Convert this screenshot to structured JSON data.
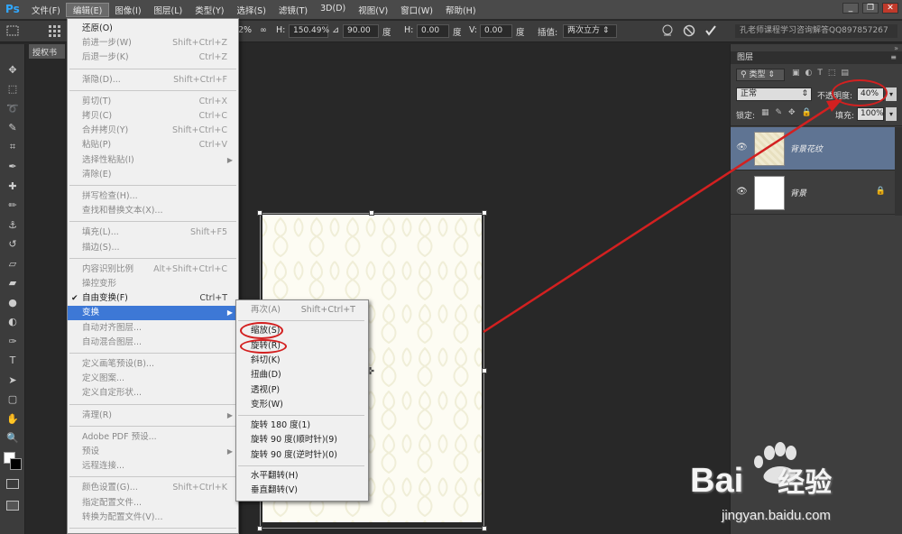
{
  "app": {
    "logo": "Ps"
  },
  "menubar": {
    "items": [
      "文件(F)",
      "编辑(E)",
      "图像(I)",
      "图层(L)",
      "类型(Y)",
      "选择(S)",
      "滤镜(T)",
      "3D(D)",
      "视图(V)",
      "窗口(W)",
      "帮助(H)"
    ],
    "active_index": 1
  },
  "window_controls": [
    "minimize",
    "restore",
    "close"
  ],
  "options": {
    "pct_fragment": "2%",
    "h_label": "H:",
    "h_value": "150.49%",
    "angle_value": "90.00",
    "deg1": "度",
    "hskew_label": "H:",
    "hskew_value": "0.00",
    "deg2": "度",
    "vskew_label": "V:",
    "vskew_value": "0.00",
    "deg3": "度",
    "interp_label": "插值:",
    "interp_value": "两次立方",
    "right_text": "孔老师课程学习咨询解答QQ897857267"
  },
  "doc_tab": {
    "label": "授权书"
  },
  "edit_menu": [
    {
      "label": "还原(O)",
      "shortcut": "",
      "type": "normal"
    },
    {
      "label": "前进一步(W)",
      "shortcut": "Shift+Ctrl+Z",
      "type": "disabled"
    },
    {
      "label": "后退一步(K)",
      "shortcut": "Ctrl+Z",
      "type": "disabled"
    },
    {
      "type": "sep"
    },
    {
      "label": "渐隐(D)...",
      "shortcut": "Shift+Ctrl+F",
      "type": "disabled"
    },
    {
      "type": "sep"
    },
    {
      "label": "剪切(T)",
      "shortcut": "Ctrl+X",
      "type": "disabled"
    },
    {
      "label": "拷贝(C)",
      "shortcut": "Ctrl+C",
      "type": "disabled"
    },
    {
      "label": "合并拷贝(Y)",
      "shortcut": "Shift+Ctrl+C",
      "type": "disabled"
    },
    {
      "label": "粘贴(P)",
      "shortcut": "Ctrl+V",
      "type": "disabled"
    },
    {
      "label": "选择性粘贴(I)",
      "shortcut": "",
      "type": "disabled",
      "submenu": true
    },
    {
      "label": "清除(E)",
      "shortcut": "",
      "type": "disabled"
    },
    {
      "type": "sep"
    },
    {
      "label": "拼写检查(H)...",
      "shortcut": "",
      "type": "disabled"
    },
    {
      "label": "查找和替换文本(X)...",
      "shortcut": "",
      "type": "disabled"
    },
    {
      "type": "sep"
    },
    {
      "label": "填充(L)...",
      "shortcut": "Shift+F5",
      "type": "disabled"
    },
    {
      "label": "描边(S)...",
      "shortcut": "",
      "type": "disabled"
    },
    {
      "type": "sep"
    },
    {
      "label": "内容识别比例",
      "shortcut": "Alt+Shift+Ctrl+C",
      "type": "disabled"
    },
    {
      "label": "操控变形",
      "shortcut": "",
      "type": "disabled"
    },
    {
      "label": "自由变换(F)",
      "shortcut": "Ctrl+T",
      "type": "checked"
    },
    {
      "label": "变换",
      "shortcut": "",
      "type": "highlight",
      "submenu": true
    },
    {
      "label": "自动对齐图层...",
      "shortcut": "",
      "type": "disabled"
    },
    {
      "label": "自动混合图层...",
      "shortcut": "",
      "type": "disabled"
    },
    {
      "type": "sep"
    },
    {
      "label": "定义画笔预设(B)...",
      "shortcut": "",
      "type": "disabled"
    },
    {
      "label": "定义图案...",
      "shortcut": "",
      "type": "disabled"
    },
    {
      "label": "定义自定形状...",
      "shortcut": "",
      "type": "disabled"
    },
    {
      "type": "sep"
    },
    {
      "label": "清理(R)",
      "shortcut": "",
      "type": "disabled",
      "submenu": true
    },
    {
      "type": "sep"
    },
    {
      "label": "Adobe PDF 预设...",
      "shortcut": "",
      "type": "disabled"
    },
    {
      "label": "预设",
      "shortcut": "",
      "type": "disabled",
      "submenu": true
    },
    {
      "label": "远程连接...",
      "shortcut": "",
      "type": "disabled"
    },
    {
      "type": "sep"
    },
    {
      "label": "颜色设置(G)...",
      "shortcut": "Shift+Ctrl+K",
      "type": "disabled"
    },
    {
      "label": "指定配置文件...",
      "shortcut": "",
      "type": "disabled"
    },
    {
      "label": "转换为配置文件(V)...",
      "shortcut": "",
      "type": "disabled"
    },
    {
      "type": "sep"
    }
  ],
  "transform_menu": [
    {
      "label": "再次(A)",
      "shortcut": "Shift+Ctrl+T",
      "type": "disabled"
    },
    {
      "type": "sep"
    },
    {
      "label": "缩放(S)",
      "type": "normal",
      "circled": true
    },
    {
      "label": "旋转(R)",
      "type": "normal",
      "circled": true
    },
    {
      "label": "斜切(K)",
      "type": "normal"
    },
    {
      "label": "扭曲(D)",
      "type": "normal"
    },
    {
      "label": "透视(P)",
      "type": "normal"
    },
    {
      "label": "变形(W)",
      "type": "normal"
    },
    {
      "type": "sep"
    },
    {
      "label": "旋转 180 度(1)",
      "type": "normal"
    },
    {
      "label": "旋转 90 度(顺时针)(9)",
      "type": "normal"
    },
    {
      "label": "旋转 90 度(逆时针)(0)",
      "type": "normal"
    },
    {
      "type": "sep"
    },
    {
      "label": "水平翻转(H)",
      "type": "normal"
    },
    {
      "label": "垂直翻转(V)",
      "type": "normal"
    }
  ],
  "layers_panel": {
    "title": "图层",
    "filter_label": "类型",
    "blend_mode": "正常",
    "opacity_label": "不透明度:",
    "opacity_value": "40%",
    "lock_label": "锁定:",
    "fill_label": "填充:",
    "fill_value": "100%",
    "layers": [
      {
        "name": "背景花纹",
        "selected": true,
        "locked": false
      },
      {
        "name": "背景",
        "selected": false,
        "locked": true
      }
    ]
  },
  "watermark": {
    "brand": "Bai",
    "brand2": "经验",
    "url": "jingyan.baidu.com"
  },
  "colors": {
    "highlight": "#3d78d6",
    "annotation": "#d32020",
    "panel_selected": "#5f7493"
  }
}
